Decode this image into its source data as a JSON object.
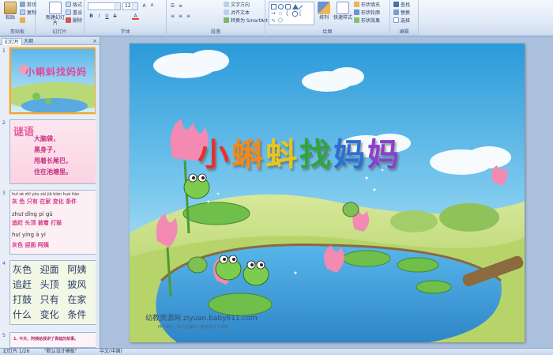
{
  "ribbon": {
    "clipboard": {
      "paste_label": "粘贴",
      "cut_label": "剪切",
      "copy_label": "复制",
      "format_painter_label": "格式刷",
      "group_label": "剪贴板"
    },
    "slides": {
      "new_slide_label": "新建幻灯片",
      "layout_label": "版式",
      "reset_label": "重设",
      "delete_label": "删除",
      "group_label": "幻灯片"
    },
    "font": {
      "font_size": "12",
      "group_label": "字体"
    },
    "paragraph": {
      "text_direction_label": "文字方向",
      "align_text_label": "对齐文本",
      "smartart_label": "转换为 SmartArt",
      "group_label": "段落"
    },
    "drawing": {
      "arrange_label": "排列",
      "quick_styles_label": "快速样式",
      "shape_fill_label": "形状填充",
      "shape_outline_label": "形状轮廓",
      "shape_effects_label": "形状效果",
      "group_label": "绘图"
    },
    "editing": {
      "find_label": "查找",
      "replace_label": "替换",
      "select_label": "选择",
      "group_label": "编辑"
    }
  },
  "leftpanel": {
    "tab_slides": "幻灯片",
    "tab_outline": "大纲",
    "close": "×",
    "thumbs": [
      {
        "num": "1",
        "title": "小蝌蚪找妈妈"
      },
      {
        "num": "2",
        "heading": "谜语",
        "lines": [
          "大脑袋，",
          "黑身子，",
          "甩着长尾巴，",
          "住在池塘里。"
        ]
      },
      {
        "num": "3",
        "rows": [
          {
            "pinyin": "huī  sè  zhī yǒu  zài jiā  biàn huà  tiáo",
            "chars": "灰 色 只有 在家 变化 条件"
          },
          {
            "pinyin": "zhuī  dǐng  pí          gǔ",
            "chars": "追赶 头顶 披着 打鼓"
          },
          {
            "pinyin": "huī     yíng   ā  yí",
            "chars": "灰色 迎面 阿姨"
          }
        ]
      },
      {
        "num": "4",
        "words": [
          "灰色",
          "迎面",
          "阿姨",
          "追赶",
          "头顶",
          "披风",
          "打鼓",
          "只有",
          "在家",
          "什么",
          "变化",
          "条件"
        ]
      },
      {
        "num": "5",
        "text": "1. 今天，阿姨给我讲了青蛙的故事。"
      }
    ]
  },
  "slide": {
    "title_chars": [
      "小",
      "蝌",
      "蚪",
      "找",
      "妈",
      "妈"
    ],
    "title_colors": [
      "#e8312a",
      "#f08a1c",
      "#e9c61a",
      "#2fa63a",
      "#2a6fd8",
      "#8a3fcf"
    ],
    "watermark": "幼教资源网 ziyuan.baby611.com",
    "watermark_sub": "PPT课件 | 幼儿园课件 | 教案设计 | 试卷"
  },
  "statusbar": {
    "slide_info": "幻灯片 1/26",
    "theme": "\"默认设计模板\"",
    "language": "中文(中国)"
  }
}
